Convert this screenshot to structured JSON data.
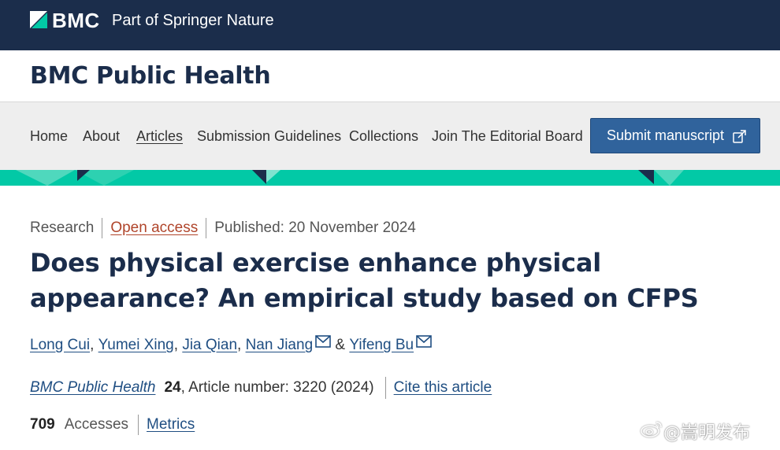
{
  "brand": {
    "name": "BMC",
    "tagline": "Part of Springer Nature",
    "logo_icon": "bmc-triangle-logo-icon"
  },
  "journal": {
    "title": "BMC Public Health"
  },
  "nav": {
    "items": [
      {
        "label": "Home"
      },
      {
        "label": "About"
      },
      {
        "label": "Articles"
      },
      {
        "label": "Submission Guidelines"
      },
      {
        "label": "Collections"
      },
      {
        "label": "Join The Editorial Board"
      }
    ],
    "submit_label": "Submit manuscript",
    "submit_icon": "external-link-icon"
  },
  "article": {
    "type": "Research",
    "access": "Open access",
    "published": "Published: 20 November 2024",
    "title": "Does physical exercise enhance physical appearance? An empirical study based on CFPS",
    "authors": [
      {
        "name": "Long Cui",
        "sep": ","
      },
      {
        "name": "Yumei Xing",
        "sep": ","
      },
      {
        "name": "Jia Qian",
        "sep": ","
      },
      {
        "name": "Nan Jiang",
        "sep": ""
      },
      {
        "name": "Yifeng Bu",
        "sep": ""
      }
    ],
    "author_conjunction": "&",
    "citation": {
      "journal": "BMC Public Health",
      "volume": "24",
      "article_number": ", Article number: 3220 (2024)",
      "cite_label": "Cite this article"
    },
    "accesses_count": "709",
    "accesses_label": "Accesses",
    "metrics_label": "Metrics"
  },
  "watermark": {
    "text": "@嵩明发布"
  },
  "colors": {
    "brand_navy": "#1b2d4b",
    "teal": "#02c9a6",
    "link_blue": "#1f4e82",
    "accent_orange": "#b0452b",
    "button_blue": "#30639c"
  }
}
